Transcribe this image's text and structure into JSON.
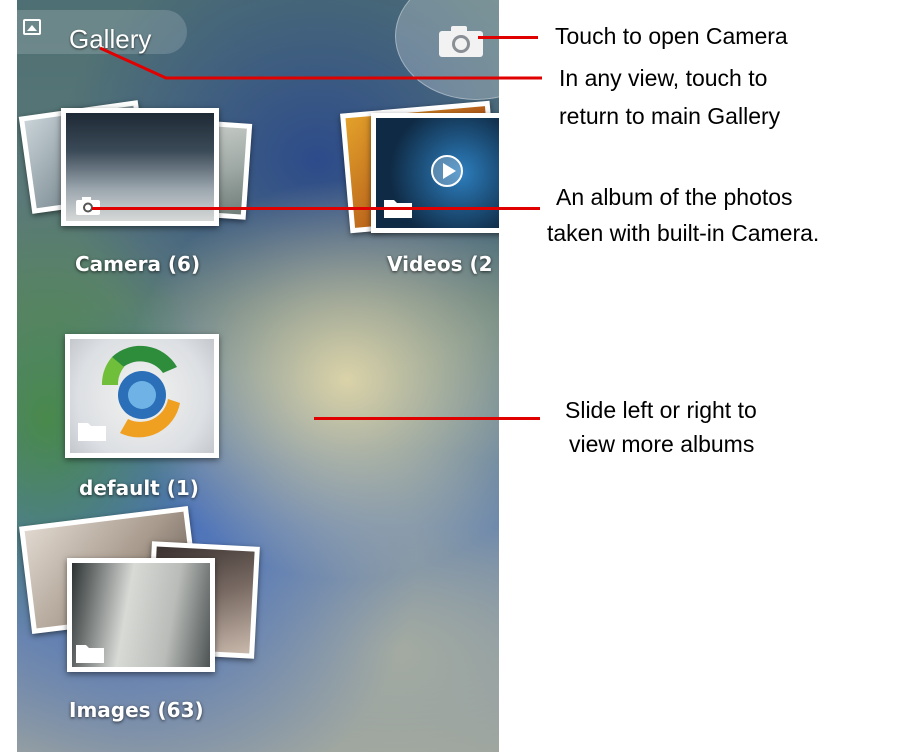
{
  "header": {
    "title": "Gallery"
  },
  "albums": [
    {
      "label": "Camera  (6)"
    },
    {
      "label": "Videos  (2"
    },
    {
      "label": "default  (1)"
    },
    {
      "label": "Images  (63)"
    }
  ],
  "annotations": {
    "camera": "Touch to open Camera",
    "gallery_line1": "In any view, touch to",
    "gallery_line2": "return to main Gallery",
    "album_line1": "An album of the photos",
    "album_line2": "taken with built-in Camera.",
    "slide_line1": "Slide left or right to",
    "slide_line2": "view more albums"
  },
  "colors": {
    "annotation_line": "#e00000"
  },
  "icons": [
    "gallery-icon",
    "camera-icon",
    "folder-icon",
    "play-icon"
  ]
}
